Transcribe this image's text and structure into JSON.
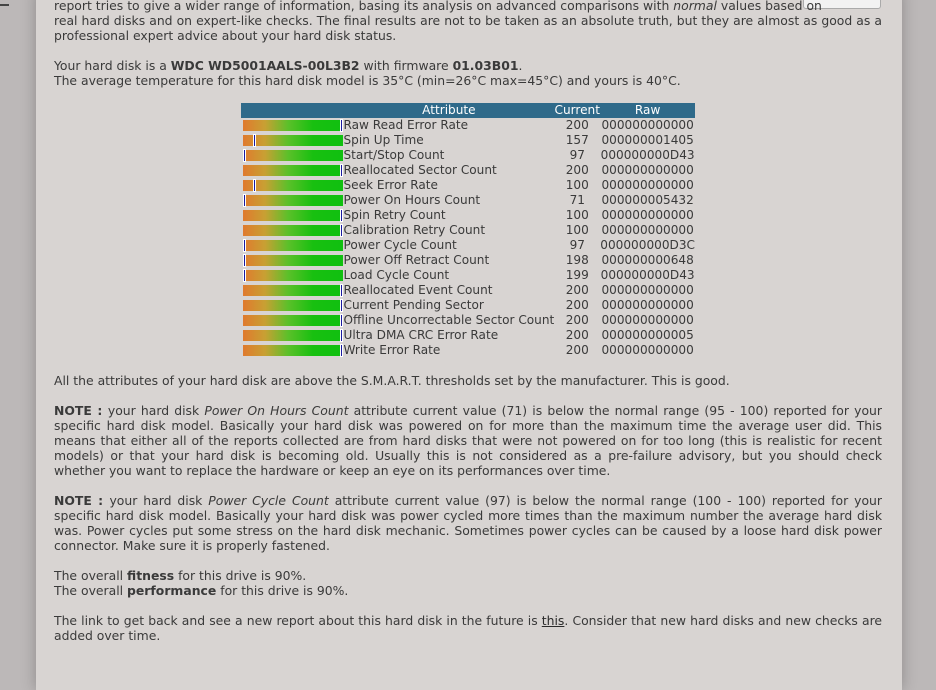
{
  "intro": {
    "line1_a": "report tries to give a wider range of information, basing its analysis on advanced comparisons with ",
    "line1_em": "normal",
    "line1_b": " values based on",
    "line2": "real hard disks and on expert-like checks. The final results are not to be taken as an absolute truth, but they are almost as good as a professional expert advice about your hard disk status."
  },
  "disk": {
    "prefix": "Your hard disk is a ",
    "model": "WDC WD5001AALS-00L3B2",
    "firmware_prefix": " with firmware ",
    "firmware": "01.03B01",
    "suffix": ".",
    "temperature_line": "The average temperature for this hard disk model is 35°C (min=26°C max=45°C) and yours is 40°C."
  },
  "table": {
    "headers": {
      "attribute": "Attribute",
      "current": "Current",
      "raw": "Raw"
    },
    "rows": [
      {
        "attribute": "Raw Read Error Rate",
        "current": "200",
        "raw": "000000000000",
        "marker_fraction": 1.0
      },
      {
        "attribute": "Spin Up Time",
        "current": "157",
        "raw": "000000001405",
        "marker_fraction": 0.1
      },
      {
        "attribute": "Start/Stop Count",
        "current": "97",
        "raw": "000000000D43",
        "marker_fraction": 0.0
      },
      {
        "attribute": "Reallocated Sector Count",
        "current": "200",
        "raw": "000000000000",
        "marker_fraction": 1.0
      },
      {
        "attribute": "Seek Error Rate",
        "current": "100",
        "raw": "000000000000",
        "marker_fraction": 0.1
      },
      {
        "attribute": "Power On Hours Count",
        "current": "71",
        "raw": "000000005432",
        "marker_fraction": 0.0
      },
      {
        "attribute": "Spin Retry Count",
        "current": "100",
        "raw": "000000000000",
        "marker_fraction": 1.0
      },
      {
        "attribute": "Calibration Retry Count",
        "current": "100",
        "raw": "000000000000",
        "marker_fraction": 1.0
      },
      {
        "attribute": "Power Cycle Count",
        "current": "97",
        "raw": "000000000D3C",
        "marker_fraction": 0.0
      },
      {
        "attribute": "Power Off Retract Count",
        "current": "198",
        "raw": "000000000648",
        "marker_fraction": 0.0
      },
      {
        "attribute": "Load Cycle Count",
        "current": "199",
        "raw": "000000000D43",
        "marker_fraction": 0.0
      },
      {
        "attribute": "Reallocated Event Count",
        "current": "200",
        "raw": "000000000000",
        "marker_fraction": 1.0
      },
      {
        "attribute": "Current Pending Sector",
        "current": "200",
        "raw": "000000000000",
        "marker_fraction": 1.0
      },
      {
        "attribute": "Offline Uncorrectable Sector Count",
        "current": "200",
        "raw": "000000000000",
        "marker_fraction": 1.0
      },
      {
        "attribute": "Ultra DMA CRC Error Rate",
        "current": "200",
        "raw": "000000000005",
        "marker_fraction": 1.0
      },
      {
        "attribute": "Write Error Rate",
        "current": "200",
        "raw": "000000000000",
        "marker_fraction": 1.0
      }
    ]
  },
  "thresholds_line": "All the attributes of your hard disk are above the S.M.A.R.T. thresholds set by the manufacturer. This is good.",
  "note1": {
    "label": "NOTE : ",
    "a": "your hard disk ",
    "em": "Power On Hours Count",
    "b": " attribute current value (71) is below the normal range (95 - 100) reported for your specific hard disk model. Basically your hard disk was powered on for more than the maximum time the average user did. This means that either all of the reports collected are from hard disks that were not powered on for too long (this is realistic for recent models) or that your hard disk is becoming old. Usually this is not considered as a pre-failure advisory, but you should check whether you want to replace the hardware or keep an eye on its performances over time."
  },
  "note2": {
    "label": "NOTE : ",
    "a": "your hard disk ",
    "em": "Power Cycle Count",
    "b": " attribute current value (97) is below the normal range (100 - 100) reported for your specific hard disk model. Basically your hard disk was power cycled more times than the maximum number the average hard disk was. Power cycles put some stress on the hard disk mechanic. Sometimes power cycles can be caused by a loose hard disk power connector. Make sure it is properly fastened."
  },
  "fitness": {
    "a": "The overall ",
    "bold": "fitness",
    "b": " for this drive is 90%."
  },
  "performance": {
    "a": "The overall ",
    "bold": "performance",
    "b": " for this drive is 90%."
  },
  "link_para": {
    "a": "The link to get back and see a new report about this hard disk in the future is ",
    "link": "this",
    "b": ". Consider that new hard disks and new checks are added over time."
  }
}
